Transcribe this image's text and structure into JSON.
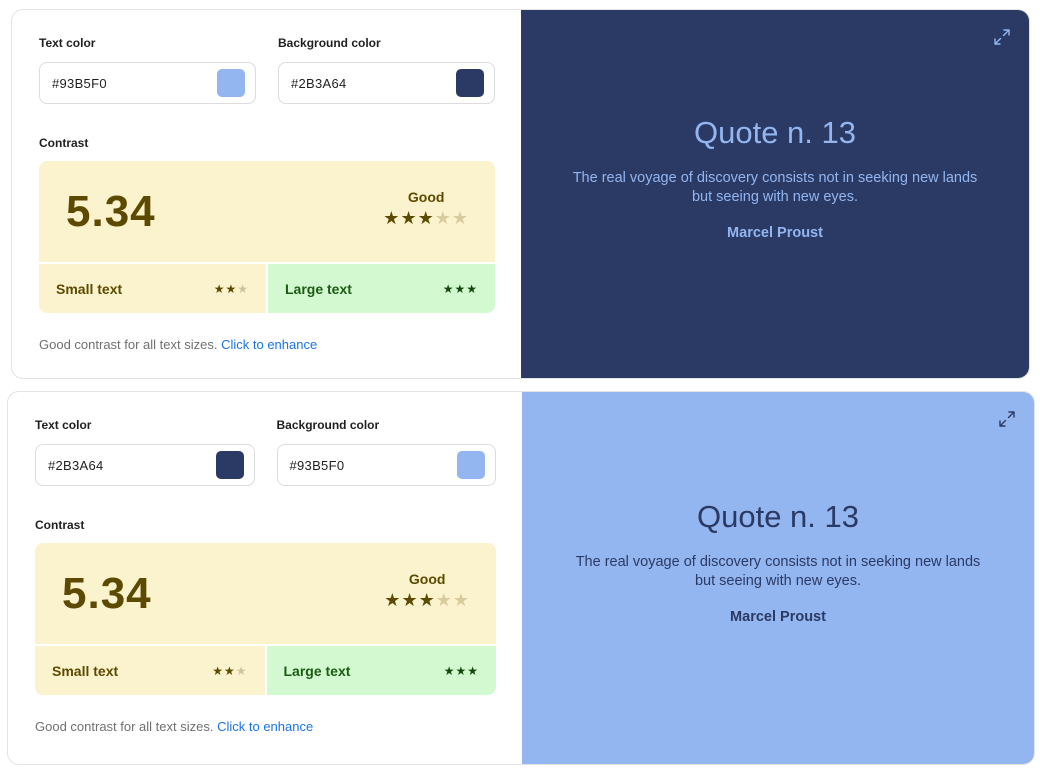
{
  "cards": [
    {
      "text_color": {
        "label": "Text color",
        "value": "#93B5F0",
        "swatch": "#93B5F0"
      },
      "background_color": {
        "label": "Background color",
        "value": "#2B3A64",
        "swatch": "#2B3A64"
      },
      "contrast": {
        "label": "Contrast",
        "score": "5.34",
        "rating": "Good",
        "stars": {
          "filled": 3,
          "total": 5
        },
        "small_text": {
          "label": "Small text",
          "stars": {
            "filled": 2,
            "total": 3
          }
        },
        "large_text": {
          "label": "Large text",
          "stars": {
            "filled": 3,
            "total": 3
          }
        }
      },
      "footnote": "Good contrast for all text sizes.",
      "enhance_link": "Click to enhance",
      "preview": {
        "title": "Quote n. 13",
        "quote": "The real voyage of discovery consists not in seeking new lands but seeing with new eyes.",
        "author": "Marcel Proust",
        "expand_icon": "expand-icon"
      }
    },
    {
      "text_color": {
        "label": "Text color",
        "value": "#2B3A64",
        "swatch": "#2B3A64"
      },
      "background_color": {
        "label": "Background color",
        "value": "#93B5F0",
        "swatch": "#93B5F0"
      },
      "contrast": {
        "label": "Contrast",
        "score": "5.34",
        "rating": "Good",
        "stars": {
          "filled": 3,
          "total": 5
        },
        "small_text": {
          "label": "Small text",
          "stars": {
            "filled": 2,
            "total": 3
          }
        },
        "large_text": {
          "label": "Large text",
          "stars": {
            "filled": 3,
            "total": 3
          }
        }
      },
      "footnote": "Good contrast for all text sizes.",
      "enhance_link": "Click to enhance",
      "preview": {
        "title": "Quote n. 13",
        "quote": "The real voyage of discovery consists not in seeking new lands but seeing with new eyes.",
        "author": "Marcel Proust",
        "expand_icon": "expand-icon"
      }
    }
  ]
}
